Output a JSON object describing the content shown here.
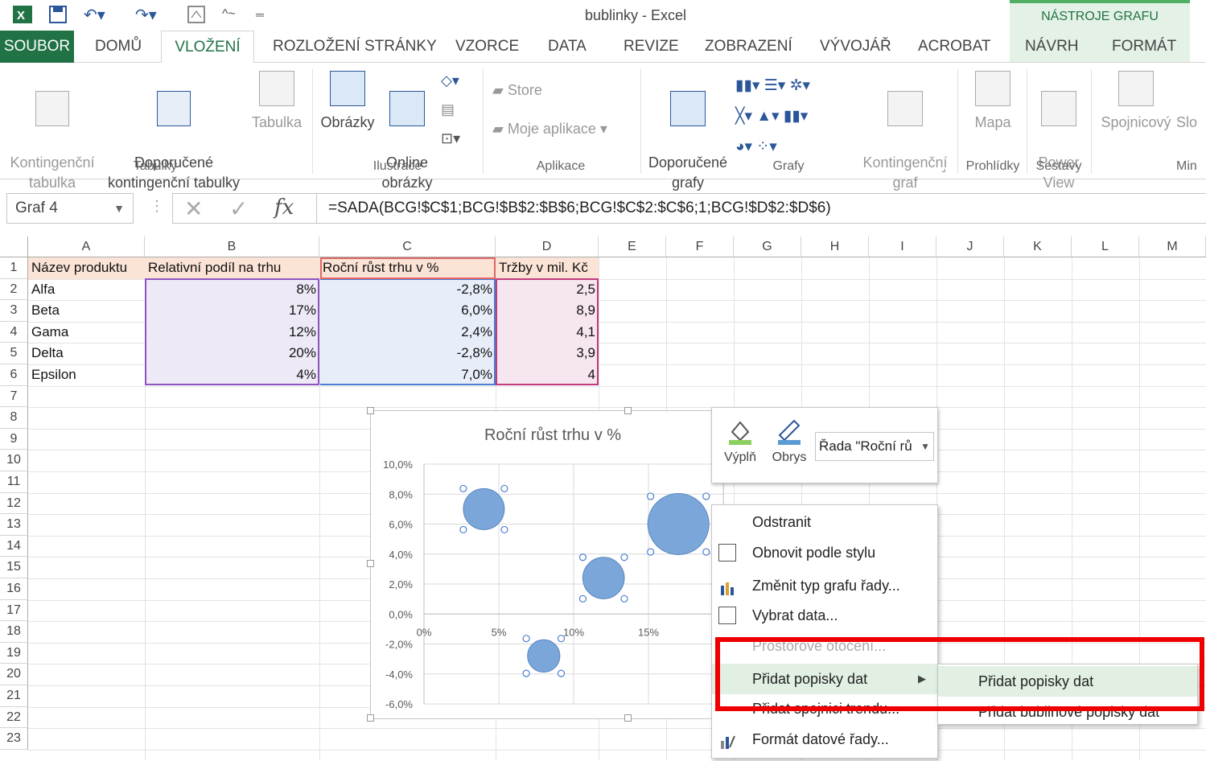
{
  "window": {
    "title": "bublinky - Excel",
    "context_tab_group": "NÁSTROJE GRAFU"
  },
  "tabs": [
    "SOUBOR",
    "DOMŮ",
    "VLOŽENÍ",
    "ROZLOŽENÍ STRÁNKY",
    "VZORCE",
    "DATA",
    "REVIZE",
    "ZOBRAZENÍ",
    "VÝVOJÁŘ",
    "ACROBAT",
    "NÁVRH",
    "FORMÁT"
  ],
  "ribbon": {
    "pivot_table": "Kontingenční\ntabulka",
    "recommended_pivot": "Doporučené\nkontingenční tabulky",
    "table": "Tabulka",
    "pictures": "Obrázky",
    "online_pictures": "Online\nobrázky",
    "store": "Store",
    "my_apps": "Moje aplikace",
    "recommended_charts": "Doporučené\ngrafy",
    "pivot_chart": "Kontingenční\ngraf",
    "map": "Mapa",
    "power_view": "Power\nView",
    "sparkline_line": "Spojnicový",
    "sparkline_col": "Slo",
    "groups": {
      "tables": "Tabulky",
      "illustrations": "Ilustrace",
      "apps": "Aplikace",
      "charts": "Grafy",
      "tours": "Prohlídky",
      "reports": "Sestavy",
      "mini": "Min"
    }
  },
  "formula_bar": {
    "name_box": "Graf 4",
    "formula": "=SADA(BCG!$C$1;BCG!$B$2:$B$6;BCG!$C$2:$C$6;1;BCG!$D$2:$D$6)",
    "fx": "fx"
  },
  "sheet": {
    "columns": [
      "A",
      "B",
      "C",
      "D",
      "E",
      "F",
      "G",
      "H",
      "I",
      "J",
      "K",
      "L",
      "M"
    ],
    "rows": [
      "1",
      "2",
      "3",
      "4",
      "5",
      "6",
      "7",
      "8",
      "9",
      "10",
      "11",
      "12",
      "13",
      "14",
      "15",
      "16",
      "17",
      "18",
      "19",
      "20",
      "21",
      "22",
      "23"
    ],
    "headers": [
      "Název produktu",
      "Relativní podíl na trhu",
      "Roční růst trhu v %",
      "Tržby v mil. Kč"
    ],
    "data": [
      [
        "Alfa",
        "8%",
        "-2,8%",
        "2,5"
      ],
      [
        "Beta",
        "17%",
        "6,0%",
        "8,9"
      ],
      [
        "Gama",
        "12%",
        "2,4%",
        "4,1"
      ],
      [
        "Delta",
        "20%",
        "-2,8%",
        "3,9"
      ],
      [
        "Epsilon",
        "4%",
        "7,0%",
        "4"
      ]
    ]
  },
  "chart_data": {
    "type": "scatter",
    "title": "Roční růst trhu v %",
    "x_ticks": [
      "0%",
      "5%",
      "10%",
      "15%"
    ],
    "y_ticks": [
      "10,0%",
      "8,0%",
      "6,0%",
      "4,0%",
      "2,0%",
      "0,0%",
      "-2,0%",
      "-4,0%",
      "-6,0%"
    ],
    "xlim": [
      0,
      0.2
    ],
    "ylim": [
      -6,
      10
    ],
    "points": [
      {
        "x": 0.04,
        "y": 7.0,
        "size": 4
      },
      {
        "x": 0.12,
        "y": 2.4,
        "size": 4.1
      },
      {
        "x": 0.08,
        "y": -2.8,
        "size": 2.5
      },
      {
        "x": 0.17,
        "y": 6.0,
        "size": 8.9
      }
    ],
    "color": "#7aa6d9"
  },
  "mini_toolbar": {
    "fill": "Výplň",
    "outline": "Obrys",
    "series_select": "Řada \"Roční rů"
  },
  "context_menu": {
    "items": [
      {
        "label": "Odstranit",
        "disabled": false
      },
      {
        "label": "Obnovit podle stylu",
        "disabled": false
      },
      {
        "label": "Změnit typ grafu řady...",
        "disabled": false
      },
      {
        "label": "Vybrat data...",
        "disabled": false
      },
      {
        "label": "Prostorové otočení...",
        "disabled": true
      },
      {
        "label": "Přidat popisky dat",
        "disabled": false
      },
      {
        "label": "Přidat spojnici trendu...",
        "disabled": false
      },
      {
        "label": "Formát datové řady...",
        "disabled": false
      }
    ]
  },
  "submenu": {
    "items": [
      "Přidat popisky dat",
      "Přidat bublinové popisky dat"
    ]
  },
  "colors": {
    "excel_green": "#217346",
    "highlight": "#e1f0e3",
    "annotation_red": "#ee0000",
    "bubble": "#7aa6d9"
  }
}
